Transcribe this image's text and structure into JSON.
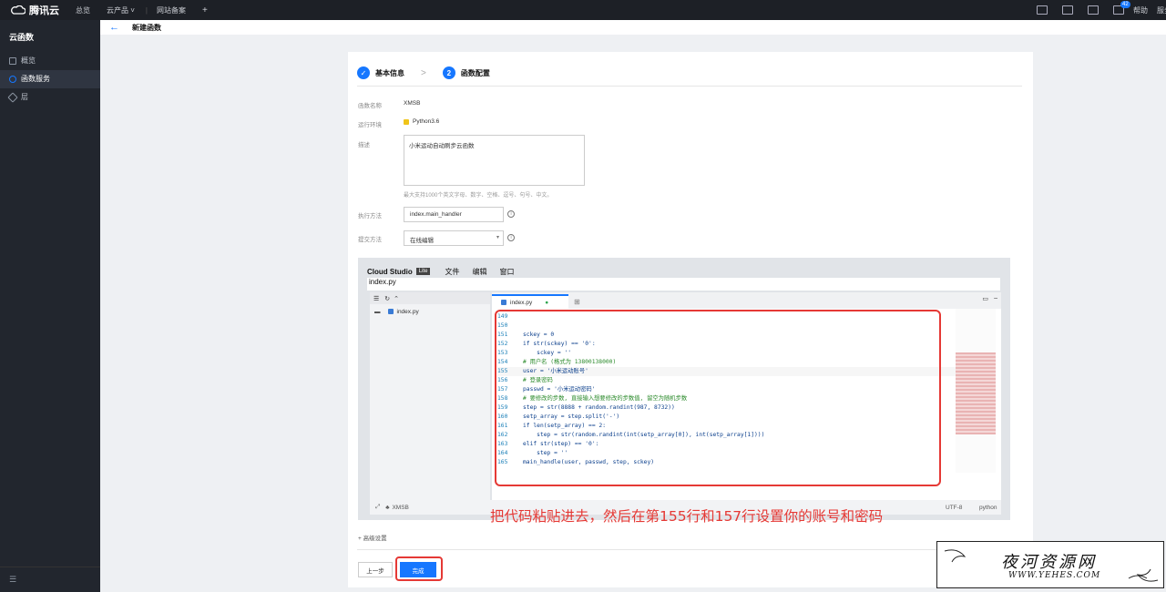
{
  "topbar": {
    "brand": "腾讯云",
    "nav": [
      "总览",
      "云产品 ˅",
      "网站备案"
    ],
    "plus": "+",
    "badge_count": "42",
    "help": "帮助",
    "more": "服务"
  },
  "sidebar": {
    "title": "云函数",
    "items": [
      {
        "label": "概览",
        "active": false
      },
      {
        "label": "函数服务",
        "active": true
      },
      {
        "label": "层",
        "active": false
      }
    ],
    "footer_icon": "☰"
  },
  "page": {
    "back": "←",
    "title": "新建函数"
  },
  "steps": [
    {
      "label": "基本信息",
      "mark": "✓"
    },
    {
      "label": "函数配置",
      "mark": "2"
    }
  ],
  "step_sep": ">",
  "form": {
    "name_label": "函数名称",
    "name_value": "XMSB",
    "runtime_label": "运行环境",
    "runtime_value": "Python3.6",
    "desc_label": "描述",
    "desc_value": "小米运动自动刷步云函数",
    "desc_hint": "最大支持1000个英文字母、数字、空格、逗号、句号、中文。",
    "handler_label": "执行方法",
    "handler_value": "index.main_handler",
    "submit_label": "提交方法",
    "submit_value": "在线编辑",
    "info": "i"
  },
  "studio": {
    "brand": "Cloud Studio",
    "lite": "Lite",
    "menus": [
      "文件",
      "编辑",
      "窗口"
    ],
    "path": "index.py",
    "tree_file": "index.py",
    "tab": "index.py",
    "tab_dot": "●",
    "status_project": "XMSB",
    "encoding": "UTF-8",
    "language": "python"
  },
  "code_lines": [
    {
      "n": "149",
      "t": ""
    },
    {
      "n": "150",
      "t": ""
    },
    {
      "n": "151",
      "t": "sckey = 0"
    },
    {
      "n": "152",
      "t": "if str(sckey) == '0':"
    },
    {
      "n": "153",
      "t": "    sckey = ''"
    },
    {
      "n": "154",
      "t": "# 用户名 (格式为 13800138000)"
    },
    {
      "n": "155",
      "t": "user = '小米运动账号'"
    },
    {
      "n": "156",
      "t": "# 登录密码"
    },
    {
      "n": "157",
      "t": "passwd = '小米运动密码'"
    },
    {
      "n": "158",
      "t": "# 要修改的步数, 直接输入想要修改的步数值, 留空为随机步数"
    },
    {
      "n": "159",
      "t": "step = str(8888 + random.randint(987, 8732))"
    },
    {
      "n": "160",
      "t": "setp_array = step.split('-')"
    },
    {
      "n": "161",
      "t": "if len(setp_array) == 2:"
    },
    {
      "n": "162",
      "t": "    step = str(random.randint(int(setp_array[0]), int(setp_array[1])))"
    },
    {
      "n": "163",
      "t": "elif str(step) == '0':"
    },
    {
      "n": "164",
      "t": "    step = ''"
    },
    {
      "n": "165",
      "t": "main_handle(user, passwd, step, sckey)"
    }
  ],
  "annotation": "把代码粘贴进去，然后在第155行和157行设置你的账号和密码",
  "advanced": "+ 高级设置",
  "buttons": {
    "prev": "上一步",
    "done": "完成"
  },
  "watermark": {
    "title": "夜河资源网",
    "url": "WWW.YEHES.COM"
  },
  "colors": {
    "accent": "#1677ff",
    "annotation": "#e53935"
  }
}
